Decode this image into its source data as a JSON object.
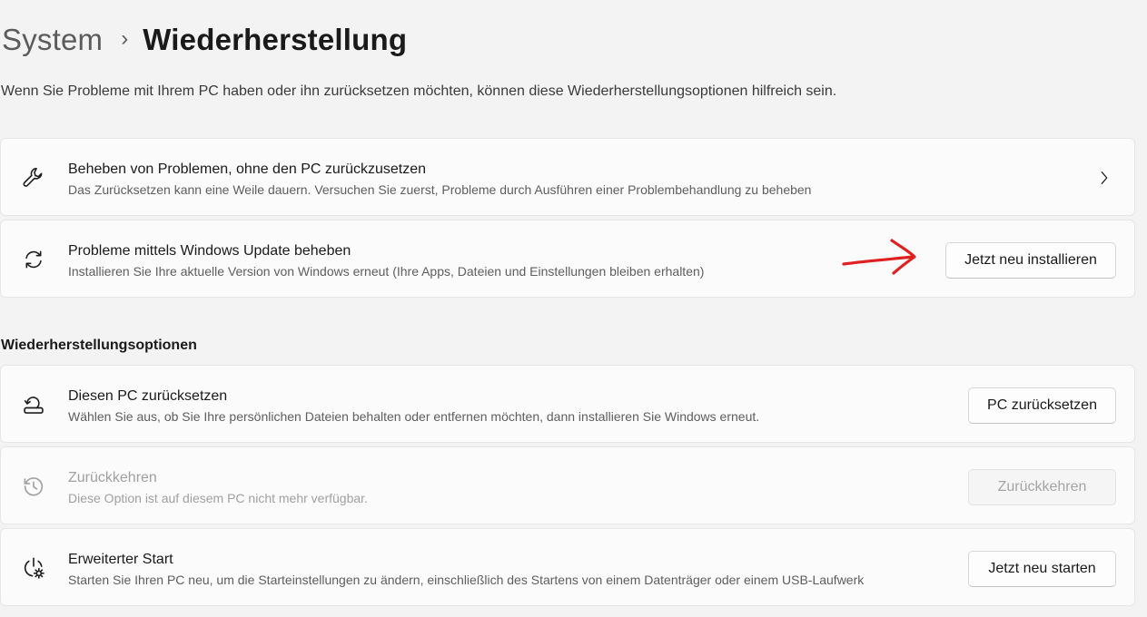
{
  "breadcrumb": {
    "parent": "System",
    "separator": "›",
    "current": "Wiederherstellung"
  },
  "description": "Wenn Sie Probleme mit Ihrem PC haben oder ihn zurücksetzen möchten, können diese Wiederherstellungsoptionen hilfreich sein.",
  "top_cards": [
    {
      "title": "Beheben von Problemen, ohne den PC zurückzusetzen",
      "subtitle": "Das Zurücksetzen kann eine Weile dauern. Versuchen Sie zuerst, Probleme durch Ausführen einer Problembehandlung zu beheben",
      "icon": "wrench-icon"
    },
    {
      "title": "Probleme mittels Windows Update beheben",
      "subtitle": "Installieren Sie Ihre aktuelle Version von Windows erneut (Ihre Apps, Dateien und Einstellungen bleiben erhalten)",
      "button": "Jetzt neu installieren",
      "icon": "sync-icon"
    }
  ],
  "section_heading": "Wiederherstellungsoptionen",
  "options": [
    {
      "title": "Diesen PC zurücksetzen",
      "subtitle": "Wählen Sie aus, ob Sie Ihre persönlichen Dateien behalten oder entfernen möchten, dann installieren Sie Windows erneut.",
      "button": "PC zurücksetzen",
      "icon": "reset-pc-icon"
    },
    {
      "title": "Zurückkehren",
      "subtitle": "Diese Option ist auf diesem PC nicht mehr verfügbar.",
      "button": "Zurückkehren",
      "icon": "history-icon",
      "disabled": true
    },
    {
      "title": "Erweiterter Start",
      "subtitle": "Starten Sie Ihren PC neu, um die Starteinstellungen zu ändern, einschließlich des Startens von einem Datenträger oder einem USB-Laufwerk",
      "button": "Jetzt neu starten",
      "icon": "advanced-startup-icon"
    }
  ],
  "colors": {
    "background": "#f3f3f3",
    "card": "#fbfbfb",
    "annotation": "#e02020"
  }
}
